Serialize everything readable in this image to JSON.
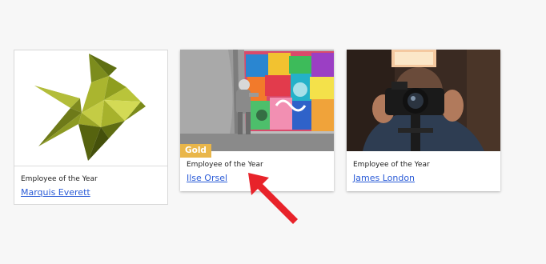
{
  "cards": [
    {
      "image_icon": "geometric-fish-icon",
      "subtitle": "Employee of the Year",
      "name": "Marquis Everett"
    },
    {
      "image_icon": "street-art-graffiti-photo",
      "badge": "Gold",
      "badge_color": "#e9b64a",
      "subtitle": "Employee of the Year",
      "name": "Ilse Orsel"
    },
    {
      "image_icon": "photographer-camera-photo",
      "subtitle": "Employee of the Year",
      "name": "James London"
    }
  ],
  "annotation": {
    "icon": "red-arrow-icon",
    "color": "#e8232a"
  },
  "colors": {
    "link": "#2a5bd7",
    "background": "#f7f7f7"
  }
}
